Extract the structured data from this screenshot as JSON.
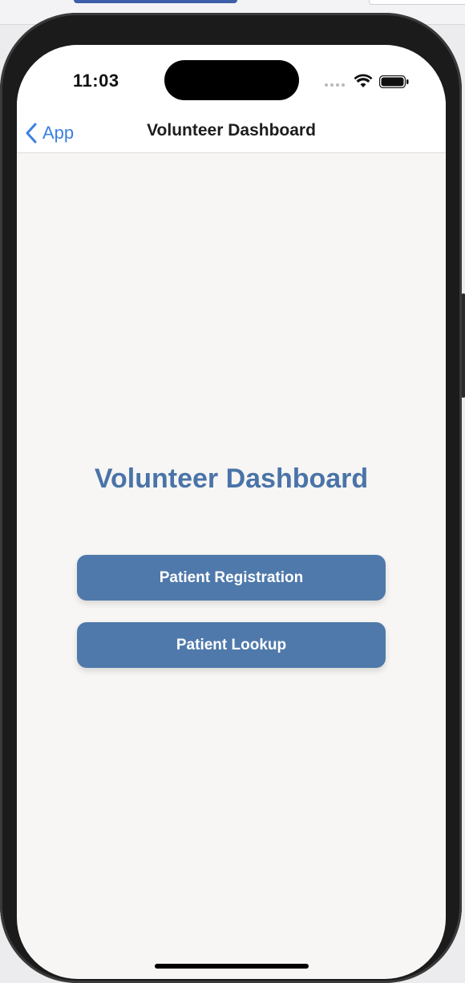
{
  "status_bar": {
    "time": "11:03"
  },
  "nav": {
    "back_label": "App",
    "title": "Volunteer Dashboard"
  },
  "dashboard": {
    "heading": "Volunteer Dashboard",
    "buttons": [
      {
        "label": "Patient Registration"
      },
      {
        "label": "Patient Lookup"
      }
    ]
  },
  "colors": {
    "accent": "#3b80e0",
    "heading": "#4a74a8",
    "button": "#4f79ab",
    "background": "#f7f6f4"
  },
  "icons": {
    "back": "chevron-left-icon",
    "wifi": "wifi-icon",
    "battery": "battery-icon",
    "signal": "signal-icon"
  }
}
